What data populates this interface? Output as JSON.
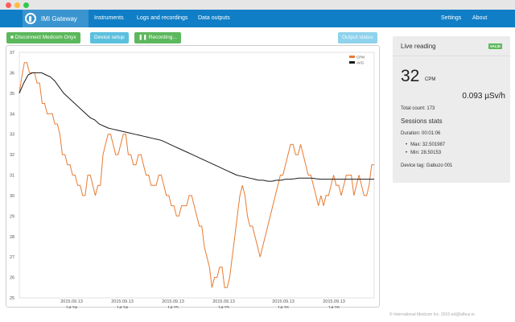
{
  "window": {
    "buttons": [
      "close",
      "minimize",
      "zoom"
    ]
  },
  "navbar": {
    "brand": "IMI Gateway",
    "items": [
      "Instruments",
      "Logs and recordings",
      "Data outputs"
    ],
    "right_items": [
      "Settings",
      "About"
    ],
    "color": "#0f7ec6"
  },
  "toolbar": {
    "disconnect_label": "Disconnect Medcom Onyx",
    "device_setup_label": "Device setup",
    "recording_label": "Recording...",
    "output_status_label": "Output status"
  },
  "live": {
    "title": "Live reading",
    "badge": "VALID",
    "cpm_value": "32",
    "cpm_unit": "CPM",
    "dose_rate": "0.093 µSv/h",
    "total_count": "Total count: 173"
  },
  "sessions": {
    "title": "Sessions stats",
    "duration": "Duration: 00:01:06",
    "max": "Max: 32.501987",
    "min": "Min: 28.50153",
    "device_tag": "Device tag: Gabuzo 001"
  },
  "footer": "© International Medcom Inc. 2015 ed@lafleur.io",
  "chart_data": {
    "type": "line",
    "ylim": [
      25,
      37
    ],
    "yticks": [
      25,
      26,
      27,
      28,
      29,
      30,
      31,
      32,
      33,
      34,
      35,
      36,
      37
    ],
    "xlabels": [
      [
        "2015.09.13",
        "14:24"
      ],
      [
        "2015.09.13",
        "14:24"
      ],
      [
        "2015.09.13",
        "14:25"
      ],
      [
        "2015.09.13",
        "14:25"
      ],
      [
        "2015.09.13",
        "14:26"
      ],
      [
        "2015.09.13",
        "14:26"
      ]
    ],
    "colors": {
      "CPM": "#e87a32",
      "AVG": "#1a1a1a"
    },
    "series": [
      {
        "name": "CPM",
        "values": [
          35,
          35.8,
          36.5,
          36.5,
          36,
          36,
          36,
          35.5,
          35.5,
          34.5,
          34.5,
          34,
          34,
          34,
          33.5,
          33.5,
          33,
          32,
          32,
          31.5,
          31.5,
          31,
          31,
          30.5,
          30.5,
          30,
          30,
          31,
          31,
          30.5,
          30,
          30.5,
          30.5,
          32,
          32.5,
          33,
          33,
          32.5,
          32,
          32,
          32.5,
          33,
          33,
          32,
          32,
          31.5,
          31.5,
          32,
          32,
          31.5,
          31,
          31,
          30.5,
          30.5,
          30.5,
          31,
          31,
          30.5,
          30,
          30,
          29.5,
          29.5,
          29,
          29,
          29.5,
          29.5,
          29.5,
          30,
          30,
          29.5,
          29,
          28.5,
          28.5,
          27.5,
          27,
          26.5,
          25.5,
          26,
          26,
          26.5,
          26.5,
          25.5,
          25.5,
          26,
          27,
          28,
          29,
          30,
          30.5,
          30,
          29,
          28.5,
          28.5,
          28,
          27.5,
          27,
          27.5,
          28,
          28.5,
          29,
          29.5,
          30,
          30.5,
          31,
          31,
          31.5,
          32,
          32.5,
          32.5,
          32,
          32,
          32.5,
          32,
          31.5,
          31,
          31,
          30.5,
          30,
          29.5,
          30,
          29.5,
          30,
          30,
          30.5,
          31,
          30.5,
          30.5,
          30,
          30.5,
          31,
          31,
          31,
          30,
          30.5,
          31,
          30.5,
          30,
          30,
          30.5,
          31.5,
          31.5
        ]
      },
      {
        "name": "AVG",
        "values": [
          35,
          35.5,
          35.9,
          36,
          36,
          36,
          35.9,
          35.8,
          35.6,
          35.3,
          35,
          34.8,
          34.6,
          34.4,
          34.2,
          34,
          33.8,
          33.7,
          33.5,
          33.4,
          33.3,
          33.25,
          33.2,
          33.15,
          33.1,
          33.05,
          33,
          32.95,
          32.9,
          32.85,
          32.8,
          32.75,
          32.7,
          32.6,
          32.5,
          32.4,
          32.3,
          32.2,
          32.1,
          32,
          31.9,
          31.8,
          31.7,
          31.6,
          31.5,
          31.4,
          31.3,
          31.2,
          31.1,
          31,
          30.95,
          30.9,
          30.85,
          30.8,
          30.75,
          30.75,
          30.7,
          30.7,
          30.75,
          30.75,
          30.8,
          30.8,
          30.82,
          30.85,
          30.85,
          30.85,
          30.85,
          30.82,
          30.8,
          30.8,
          30.8,
          30.8,
          30.8,
          30.8,
          30.8,
          30.8,
          30.8,
          30.8,
          30.8,
          30.8,
          30.8
        ]
      }
    ]
  }
}
